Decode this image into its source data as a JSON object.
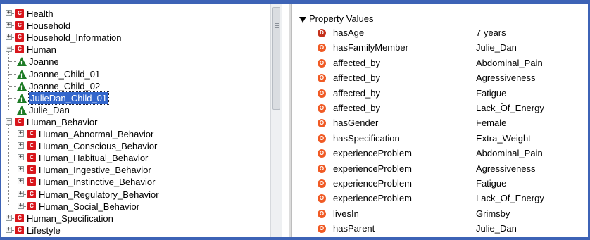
{
  "tree": {
    "nodes": [
      {
        "label": "Health",
        "type": "class",
        "level": 0,
        "state": "collapsed"
      },
      {
        "label": "Household",
        "type": "class",
        "level": 0,
        "state": "collapsed"
      },
      {
        "label": "Household_Information",
        "type": "class",
        "level": 0,
        "state": "collapsed"
      },
      {
        "label": "Human",
        "type": "class",
        "level": 0,
        "state": "expanded"
      },
      {
        "label": "Joanne",
        "type": "individual",
        "level": 1
      },
      {
        "label": "Joanne_Child_01",
        "type": "individual",
        "level": 1
      },
      {
        "label": "Joanne_Child_02",
        "type": "individual",
        "level": 1
      },
      {
        "label": "JulieDan_Child_01",
        "type": "individual",
        "level": 1,
        "selected": true
      },
      {
        "label": "Julie_Dan",
        "type": "individual",
        "level": 1
      },
      {
        "label": "Human_Behavior",
        "type": "class",
        "level": 0,
        "state": "expanded"
      },
      {
        "label": "Human_Abnormal_Behavior",
        "type": "class",
        "level": 1,
        "state": "collapsed"
      },
      {
        "label": "Human_Conscious_Behavior",
        "type": "class",
        "level": 1,
        "state": "collapsed"
      },
      {
        "label": "Human_Habitual_Behavior",
        "type": "class",
        "level": 1,
        "state": "collapsed"
      },
      {
        "label": "Human_Ingestive_Behavior",
        "type": "class",
        "level": 1,
        "state": "collapsed"
      },
      {
        "label": "Human_Instinctive_Behavior",
        "type": "class",
        "level": 1,
        "state": "collapsed"
      },
      {
        "label": "Human_Regulatory_Behavior",
        "type": "class",
        "level": 1,
        "state": "collapsed"
      },
      {
        "label": "Human_Social_Behavior",
        "type": "class",
        "level": 1,
        "state": "collapsed"
      },
      {
        "label": "Human_Specification",
        "type": "class",
        "level": 0,
        "state": "collapsed"
      },
      {
        "label": "Lifestyle",
        "type": "class",
        "level": 0,
        "state": "collapsed"
      }
    ],
    "class_icon_letter": "C",
    "expand_glyph": "+",
    "collapse_glyph": "−"
  },
  "properties": {
    "header": "Property Values",
    "rows": [
      {
        "name": "hasAge",
        "value": "7 years",
        "kind": "data",
        "icon": "D"
      },
      {
        "name": "hasFamilyMember",
        "value": "Julie_Dan",
        "kind": "object",
        "icon": "O"
      },
      {
        "name": "affected_by",
        "value": "Abdominal_Pain",
        "kind": "object",
        "icon": "O"
      },
      {
        "name": "affected_by",
        "value": "Agressiveness",
        "kind": "object",
        "icon": "O"
      },
      {
        "name": "affected_by",
        "value": "Fatigue",
        "kind": "object",
        "icon": "O"
      },
      {
        "name": "affected_by",
        "value": "Lack_Of_Energy",
        "kind": "object",
        "icon": "O"
      },
      {
        "name": "hasGender",
        "value": "Female",
        "kind": "object",
        "icon": "O"
      },
      {
        "name": "hasSpecification",
        "value": "Extra_Weight",
        "kind": "object",
        "icon": "O"
      },
      {
        "name": "experienceProblem",
        "value": "Abdominal_Pain",
        "kind": "object",
        "icon": "O"
      },
      {
        "name": "experienceProblem",
        "value": "Agressiveness",
        "kind": "object",
        "icon": "O"
      },
      {
        "name": "experienceProblem",
        "value": "Fatigue",
        "kind": "object",
        "icon": "O"
      },
      {
        "name": "experienceProblem",
        "value": "Lack_Of_Energy",
        "kind": "object",
        "icon": "O"
      },
      {
        "name": "livesIn",
        "value": "Grimsby",
        "kind": "object",
        "icon": "O"
      },
      {
        "name": "hasParent",
        "value": "Julie_Dan",
        "kind": "object",
        "icon": "O"
      }
    ]
  },
  "colors": {
    "frame": "#3d63b6",
    "class_icon": "#d8161c",
    "individual_icon": "#1e7c26",
    "object_property_icon": "#f05a24",
    "data_property_icon": "#c4311b",
    "selection": "#3366cc"
  }
}
